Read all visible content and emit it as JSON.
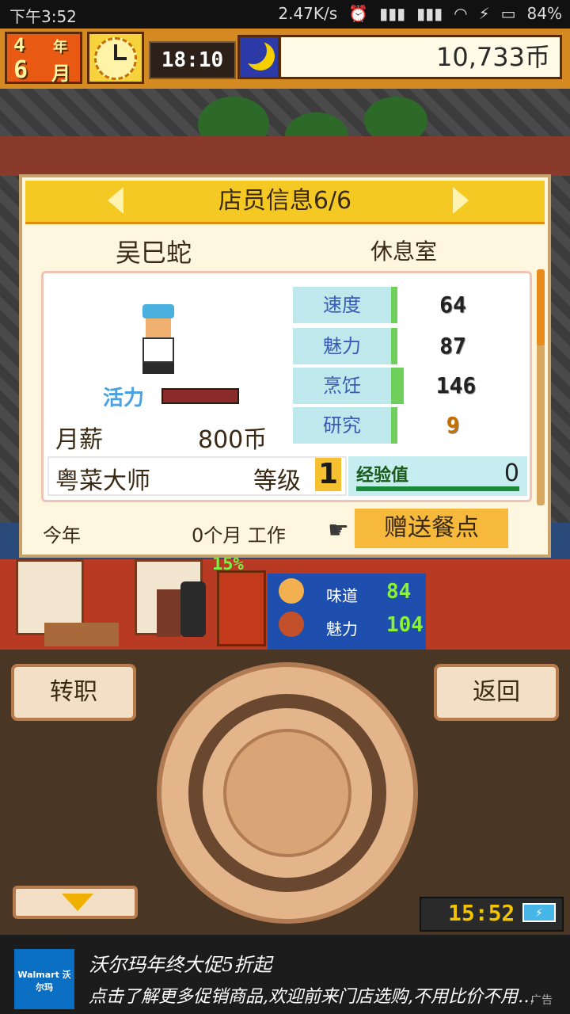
{
  "status_bar": {
    "time": "下午3:52",
    "net_speed": "2.47K/s",
    "battery": "84%"
  },
  "top_bar": {
    "year_num": "4",
    "year_label": "年",
    "month_num": "6",
    "month_label": "月",
    "game_time": "18:10",
    "money": "10,733币"
  },
  "dialog": {
    "title": "店员信息6/6",
    "staff_name": "吴巳蛇",
    "location": "休息室",
    "vitality_label": "活力",
    "salary_label": "月薪",
    "salary_value": "800币",
    "stats": [
      {
        "label": "速度",
        "value": "64"
      },
      {
        "label": "魅力",
        "value": "87"
      },
      {
        "label": "烹饪",
        "value": "146"
      },
      {
        "label": "研究",
        "value": "9"
      }
    ],
    "rank_title": "粤菜大师",
    "level_label": "等级",
    "level_value": "1",
    "exp_label": "经验值",
    "exp_value": "0",
    "this_year_label": "今年",
    "work_text": "0个月 工作",
    "gift_button": "赠送餐点"
  },
  "shop": {
    "percent": "15%",
    "taste_label": "味道",
    "taste_value": "84",
    "charm_label": "魅力",
    "charm_value": "104"
  },
  "controls": {
    "transfer_button": "转职",
    "back_button": "返回",
    "clock": "15:52"
  },
  "ad": {
    "logo_text": "Walmart 沃尔玛",
    "title": "沃尔玛年终大促5折起",
    "text": "点击了解更多促销商品,欢迎前来门店选购,不用比价不用…",
    "tag": "广告"
  }
}
